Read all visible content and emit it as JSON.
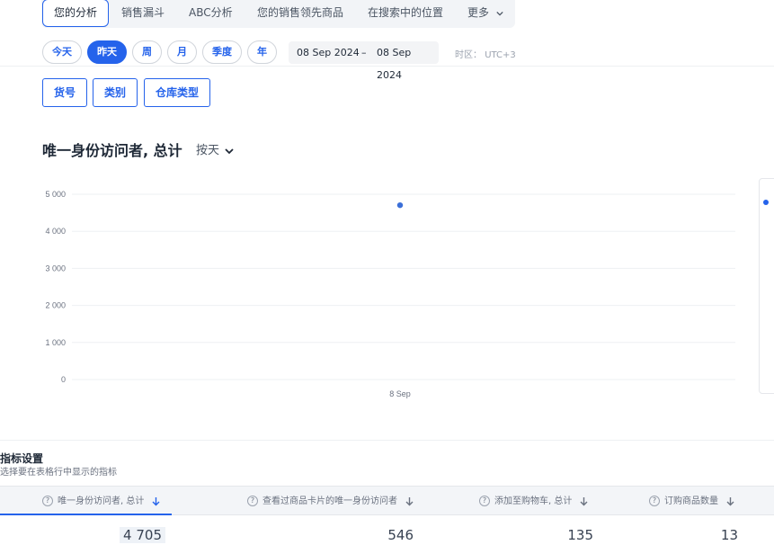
{
  "nav": {
    "tabs": [
      {
        "label": "您的分析",
        "active": true
      },
      {
        "label": "销售漏斗"
      },
      {
        "label": "ABC分析"
      },
      {
        "label": "您的销售领先商品"
      },
      {
        "label": "在搜索中的位置"
      },
      {
        "label": "更多"
      }
    ]
  },
  "period": {
    "options": [
      "今天",
      "昨天",
      "周",
      "月",
      "季度",
      "年"
    ],
    "selected": "昨天",
    "date_from": "08 Sep 2024",
    "date_sep": "–",
    "date_to": "08 Sep 2024",
    "timezone_label": "时区：",
    "timezone_value": "UTC+3"
  },
  "filters": [
    "货号",
    "类别",
    "仓库类型"
  ],
  "chart_header": {
    "title": "唯一身份访问者, 总计",
    "grouping": "按天"
  },
  "chart_data": {
    "type": "scatter",
    "x": [
      "8 Sep"
    ],
    "y_ticks": [
      "5 000",
      "4 000",
      "3 000",
      "2 000",
      "1 000",
      "0"
    ],
    "ylim": [
      0,
      5000
    ],
    "series": [
      {
        "values": [
          4705
        ],
        "color": "#3b6fd8"
      }
    ],
    "grid": true
  },
  "settings": {
    "title": "指标设置",
    "subtitle": "选择要在表格行中显示的指标"
  },
  "table": {
    "columns": [
      {
        "label": "唯一身份访问者, 总计",
        "value": "4 705",
        "sorted": true
      },
      {
        "label": "查看过商品卡片的唯一身份访问者",
        "value": "546"
      },
      {
        "label": "添加至购物车, 总计",
        "value": "135"
      },
      {
        "label": "订购商品数量",
        "value": "13"
      }
    ]
  },
  "colors": {
    "accent": "#2563eb",
    "text": "#1f2937",
    "muted": "#6b7280"
  }
}
